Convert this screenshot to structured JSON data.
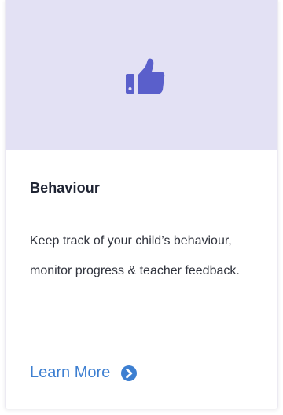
{
  "card": {
    "icon": "thumbs-up-icon",
    "title": "Behaviour",
    "description": "Keep track of your child’s behaviour, monitor progress & teacher feedback.",
    "cta_label": "Learn More",
    "cta_icon": "chevron-right-circle-icon"
  },
  "colors": {
    "banner": "#e3e1f4",
    "icon": "#5a5fcb",
    "link": "#3d7fd1",
    "title": "#1f2433",
    "text": "#30333d"
  }
}
